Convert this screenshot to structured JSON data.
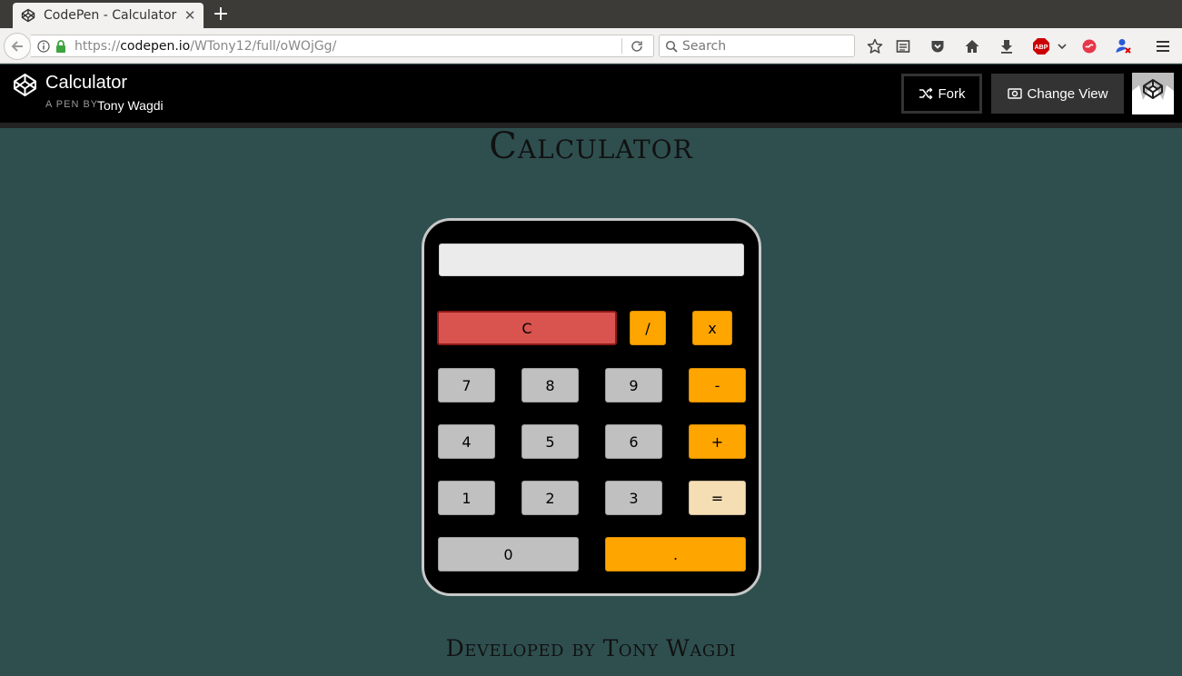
{
  "browser": {
    "tab": {
      "title": "CodePen - Calculator",
      "close_glyph": "✕"
    },
    "new_tab_glyph": "+",
    "url": {
      "scheme": "https://",
      "host": "codepen.io",
      "path": "/WTony12/full/oWOjGg/"
    },
    "search": {
      "placeholder": "Search"
    },
    "toolbar_icons": [
      "bookmark-star-icon",
      "reading-list-icon",
      "pocket-icon",
      "home-icon",
      "download-icon",
      "adblock-icon",
      "chevron-down-icon",
      "flame-icon",
      "user-blocker-icon",
      "hamburger-menu-icon"
    ],
    "adblock_label": "ABP"
  },
  "codepen": {
    "pen_title": "Calculator",
    "by_label": "A PEN BY",
    "author": "Tony Wagdi",
    "fork_label": "Fork",
    "change_view_label": "Change View"
  },
  "page": {
    "heading": "Calculator",
    "footer": "Developed by Tony Wagdi"
  },
  "calculator": {
    "display_value": "",
    "keys": {
      "clear": "C",
      "divide": "/",
      "multiply": "x",
      "seven": "7",
      "eight": "8",
      "nine": "9",
      "minus": "-",
      "four": "4",
      "five": "5",
      "six": "6",
      "plus": "+",
      "one": "1",
      "two": "2",
      "three": "3",
      "equals": "=",
      "zero": "0",
      "decimal": "."
    }
  },
  "colors": {
    "page_bg": "#2f4f4f",
    "calc_body": "#000000",
    "gray_key": "#c0c0c0",
    "operator_key": "#ffa500",
    "clear_key": "#d9534f",
    "equals_key": "#f5deb3"
  }
}
